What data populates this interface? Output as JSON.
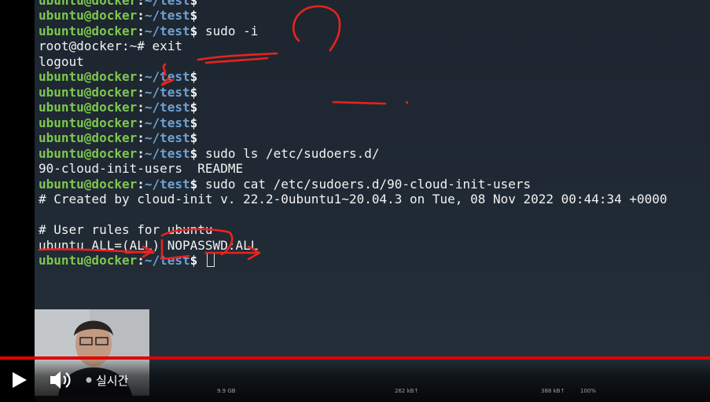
{
  "terminal": {
    "prompt_user": "ubuntu@docker",
    "prompt_sep": ":",
    "prompt_path": "~/test",
    "prompt_dollar": "$",
    "lines": [
      {
        "kind": "prompt",
        "cmd": ""
      },
      {
        "kind": "prompt",
        "cmd": ""
      },
      {
        "kind": "prompt",
        "cmd": " sudo -i"
      },
      {
        "kind": "text",
        "text": "root@docker:~# exit"
      },
      {
        "kind": "text",
        "text": "logout"
      },
      {
        "kind": "prompt",
        "cmd": ""
      },
      {
        "kind": "prompt",
        "cmd": ""
      },
      {
        "kind": "prompt",
        "cmd": ""
      },
      {
        "kind": "prompt",
        "cmd": ""
      },
      {
        "kind": "prompt",
        "cmd": ""
      },
      {
        "kind": "prompt",
        "cmd": " sudo ls /etc/sudoers.d/"
      },
      {
        "kind": "text",
        "text": "90-cloud-init-users  README"
      },
      {
        "kind": "prompt",
        "cmd": " sudo cat /etc/sudoers.d/90-cloud-init-users"
      },
      {
        "kind": "text",
        "text": "# Created by cloud-init v. 22.2-0ubuntu1~20.04.3 on Tue, 08 Nov 2022 00:44:34 +0000"
      },
      {
        "kind": "text",
        "text": ""
      },
      {
        "kind": "text",
        "text": "# User rules for ubuntu"
      },
      {
        "kind": "text",
        "text": "ubuntu ALL=(ALL) NOPASSWD:ALL"
      },
      {
        "kind": "prompt",
        "cmd": " ",
        "cursor": true
      }
    ]
  },
  "player": {
    "live_label": "실시간",
    "stats": [
      "9.9 GB",
      "262 kB↑",
      "388 kB↑",
      "100%"
    ],
    "progress": 1.0,
    "accent": "#e00000"
  },
  "icons": [
    "play-icon",
    "volume-icon",
    "live-dot-icon"
  ]
}
